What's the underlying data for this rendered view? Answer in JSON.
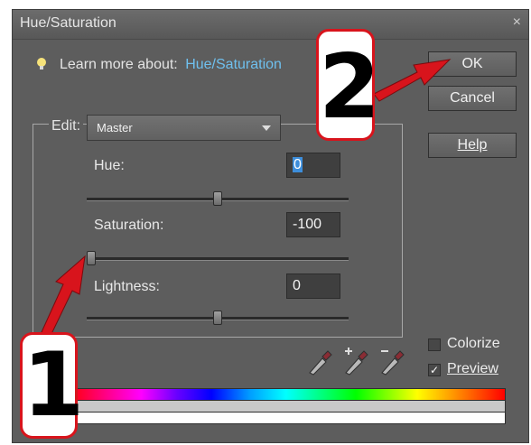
{
  "dialog": {
    "title": "Hue/Saturation",
    "close_glyph": "×",
    "learn_more_text": "Learn more about:",
    "learn_more_link": "Hue/Saturation"
  },
  "buttons": {
    "ok": "OK",
    "cancel": "Cancel",
    "help": "Help"
  },
  "edit": {
    "label": "Edit:",
    "selected": "Master"
  },
  "adjustments": {
    "hue": {
      "label": "Hue:",
      "value": "0",
      "slider_fraction": 0.5
    },
    "saturation": {
      "label": "Saturation:",
      "value": "-100",
      "slider_fraction": 0.0
    },
    "lightness": {
      "label": "Lightness:",
      "value": "0",
      "slider_fraction": 0.5
    }
  },
  "options": {
    "colorize": {
      "label": "Colorize",
      "checked": false
    },
    "preview": {
      "label": "Preview",
      "checked": true
    }
  },
  "annotations": {
    "step1": "1",
    "step2": "2"
  },
  "icons": [
    "lightbulb-icon",
    "eyedropper-icon",
    "eyedropper-plus-icon",
    "eyedropper-minus-icon",
    "close-icon",
    "chevron-down-icon",
    "checkmark-icon"
  ],
  "colors": {
    "dialog_bg": "#5d5d5d",
    "link": "#6fc0ee",
    "annotation_red": "#d8141c"
  }
}
